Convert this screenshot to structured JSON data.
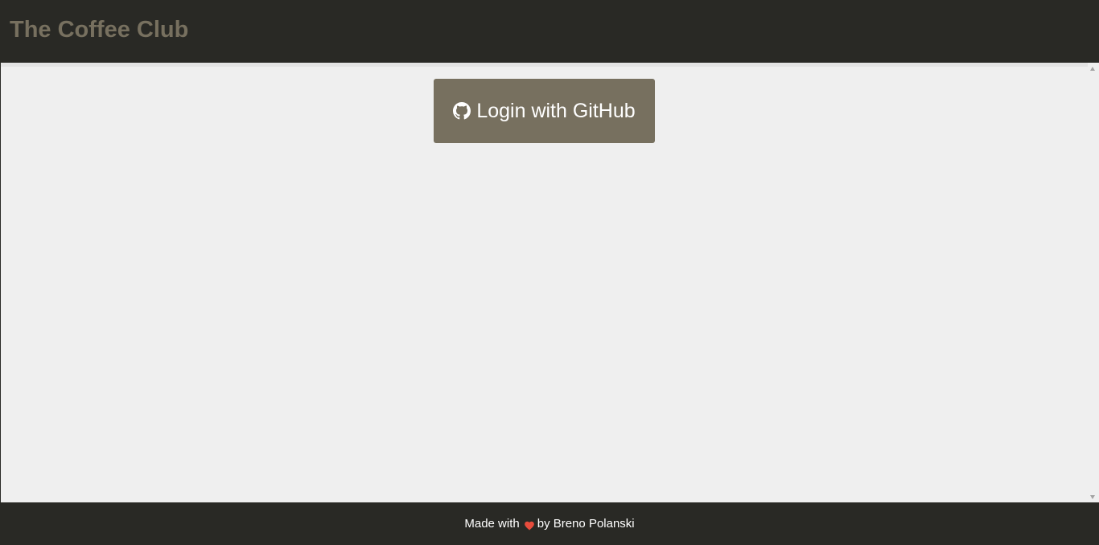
{
  "header": {
    "title": "The Coffee Club"
  },
  "main": {
    "login_button": {
      "label": "Login with GitHub",
      "icon": "github-icon"
    }
  },
  "footer": {
    "prefix": "Made with",
    "icon": "heart-icon",
    "suffix": "by Breno Polanski"
  },
  "colors": {
    "header_bg": "#292925",
    "brand": "#77705f",
    "content_bg": "#efefef",
    "heart": "#e74c3c",
    "button_text": "#ffffff"
  }
}
